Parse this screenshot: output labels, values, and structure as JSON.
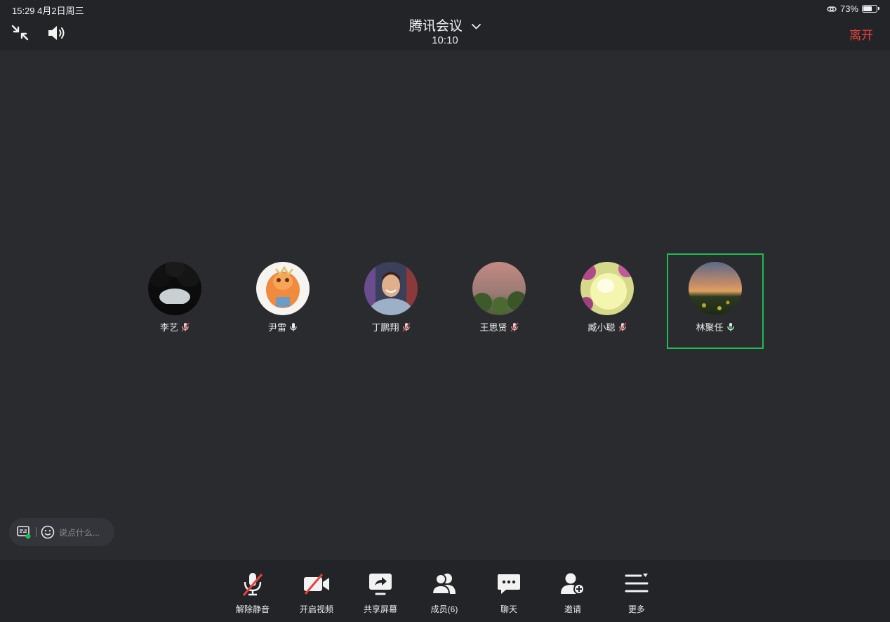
{
  "status_bar": {
    "time_date": "15:29  4月2日周三",
    "battery": "73%",
    "battery_level": 0.73
  },
  "header": {
    "title": "腾讯会议",
    "elapsed": "10:10",
    "leave_label": "离开"
  },
  "participants": [
    {
      "name": "李艺",
      "mic": "muted"
    },
    {
      "name": "尹雷",
      "mic": "on"
    },
    {
      "name": "丁鹏翔",
      "mic": "muted"
    },
    {
      "name": "王思贤",
      "mic": "muted"
    },
    {
      "name": "臧小聪",
      "mic": "muted"
    },
    {
      "name": "林聚任",
      "mic": "speaking",
      "active": true
    }
  ],
  "chat": {
    "placeholder": "说点什么..."
  },
  "toolbar": [
    {
      "label": "解除静音",
      "icon": "mic-muted-icon"
    },
    {
      "label": "开启视频",
      "icon": "camera-off-icon"
    },
    {
      "label": "共享屏幕",
      "icon": "share-screen-icon"
    },
    {
      "label": "成员(6)",
      "icon": "members-icon"
    },
    {
      "label": "聊天",
      "icon": "chat-icon"
    },
    {
      "label": "邀请",
      "icon": "invite-icon"
    },
    {
      "label": "更多",
      "icon": "more-icon"
    }
  ],
  "colors": {
    "background": "#2a2b2f",
    "bar": "#232427",
    "leave": "#e8413d",
    "active_speaker": "#1fbc52",
    "muted_slash": "#e8413d"
  }
}
